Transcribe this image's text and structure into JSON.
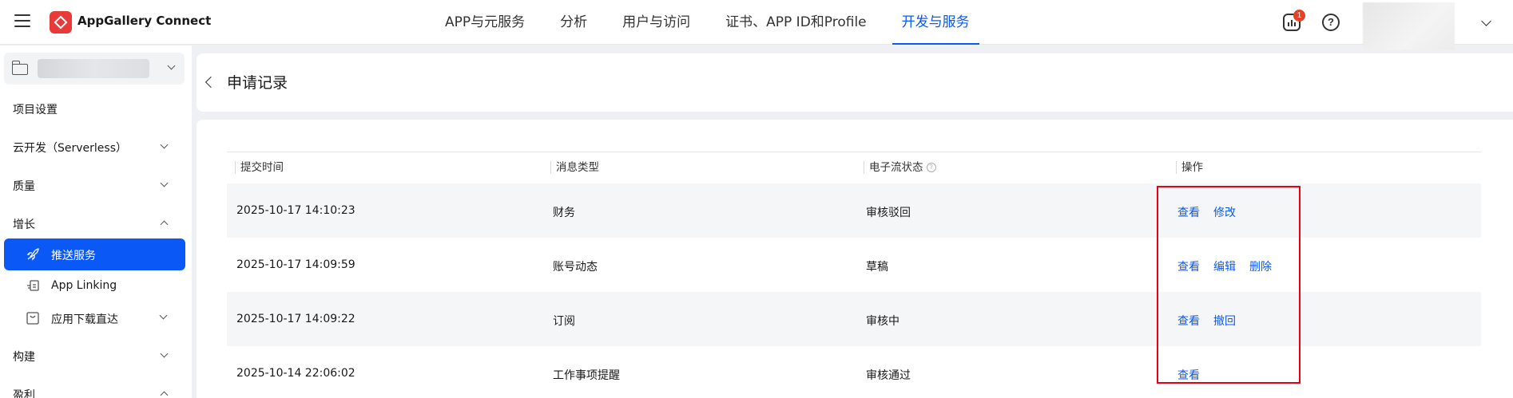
{
  "header": {
    "brand": "AppGallery Connect",
    "nav": [
      "APP与元服务",
      "分析",
      "用户与访问",
      "证书、APP ID和Profile",
      "开发与服务"
    ],
    "active_nav": "开发与服务",
    "notification_count": "1",
    "help_symbol": "?"
  },
  "sidebar": {
    "project_settings": "项目设置",
    "serverless": "云开发（Serverless）",
    "quality": "质量",
    "growth": "增长",
    "push": "推送服务",
    "app_linking": "App Linking",
    "app_download": "应用下载直达",
    "build": "构建",
    "earn": "盈利"
  },
  "page": {
    "title": "申请记录"
  },
  "table": {
    "columns": [
      "提交时间",
      "消息类型",
      "电子流状态",
      "操作"
    ],
    "help_symbol": "?",
    "rows": [
      {
        "time": "2025-10-17 14:10:23",
        "type": "财务",
        "status": "审核驳回",
        "actions": [
          "查看",
          "修改"
        ]
      },
      {
        "time": "2025-10-17 14:09:59",
        "type": "账号动态",
        "status": "草稿",
        "actions": [
          "查看",
          "编辑",
          "删除"
        ]
      },
      {
        "time": "2025-10-17 14:09:22",
        "type": "订阅",
        "status": "审核中",
        "actions": [
          "查看",
          "撤回"
        ]
      },
      {
        "time": "2025-10-14 22:06:02",
        "type": "工作事项提醒",
        "status": "审核通过",
        "actions": [
          "查看"
        ]
      }
    ]
  },
  "colors": {
    "accent": "#0a59f7",
    "highlight_box": "#e60012",
    "badge": "#e84026"
  }
}
